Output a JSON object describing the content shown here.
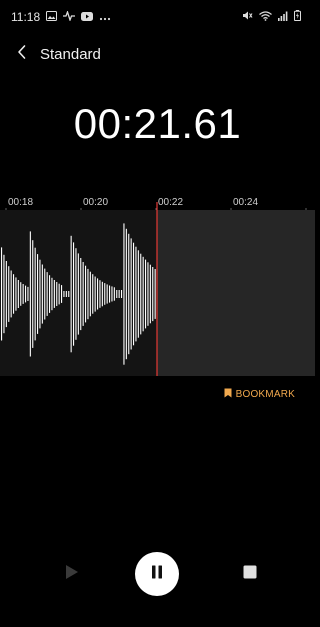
{
  "status_bar": {
    "time": "11:18",
    "left_icons": [
      "image-icon",
      "activity-icon",
      "youtube-icon",
      "more-dots-icon"
    ],
    "right_icons": [
      "mute-icon",
      "wifi-icon",
      "signal-icon",
      "battery-icon"
    ]
  },
  "header": {
    "back_icon": "chevron-left-icon",
    "title": "Standard"
  },
  "recording": {
    "elapsed": "00:21.61"
  },
  "timeline": {
    "labels": [
      "00:18",
      "00:20",
      "00:22",
      "00:24"
    ],
    "playhead_color": "#e53935",
    "waveform_color": "#ffffff",
    "recorded_bg": "#141414",
    "future_bg": "#262626"
  },
  "bookmark": {
    "label": "BOOKMARK",
    "icon": "bookmark-icon",
    "color": "#f1a94e"
  },
  "controls": {
    "play_icon": "play-icon",
    "pause_icon": "pause-icon",
    "stop_icon": "stop-icon"
  }
}
